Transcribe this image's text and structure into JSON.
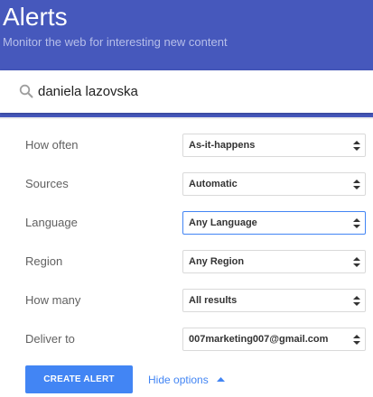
{
  "header": {
    "title": "Alerts",
    "subtitle": "Monitor the web for interesting new content"
  },
  "search": {
    "value": "daniela lazovska",
    "icon": "search-icon"
  },
  "options": {
    "how_often": {
      "label": "How often",
      "value": "As-it-happens"
    },
    "sources": {
      "label": "Sources",
      "value": "Automatic"
    },
    "language": {
      "label": "Language",
      "value": "Any Language"
    },
    "region": {
      "label": "Region",
      "value": "Any Region"
    },
    "how_many": {
      "label": "How many",
      "value": "All results"
    },
    "deliver_to": {
      "label": "Deliver to",
      "value": "007marketing007@gmail.com"
    }
  },
  "actions": {
    "create_label": "CREATE ALERT",
    "hide_options_label": "Hide options"
  },
  "colors": {
    "header_bg": "#4658bc",
    "accent": "#4285f4",
    "page_bg": "#eeeeee"
  }
}
